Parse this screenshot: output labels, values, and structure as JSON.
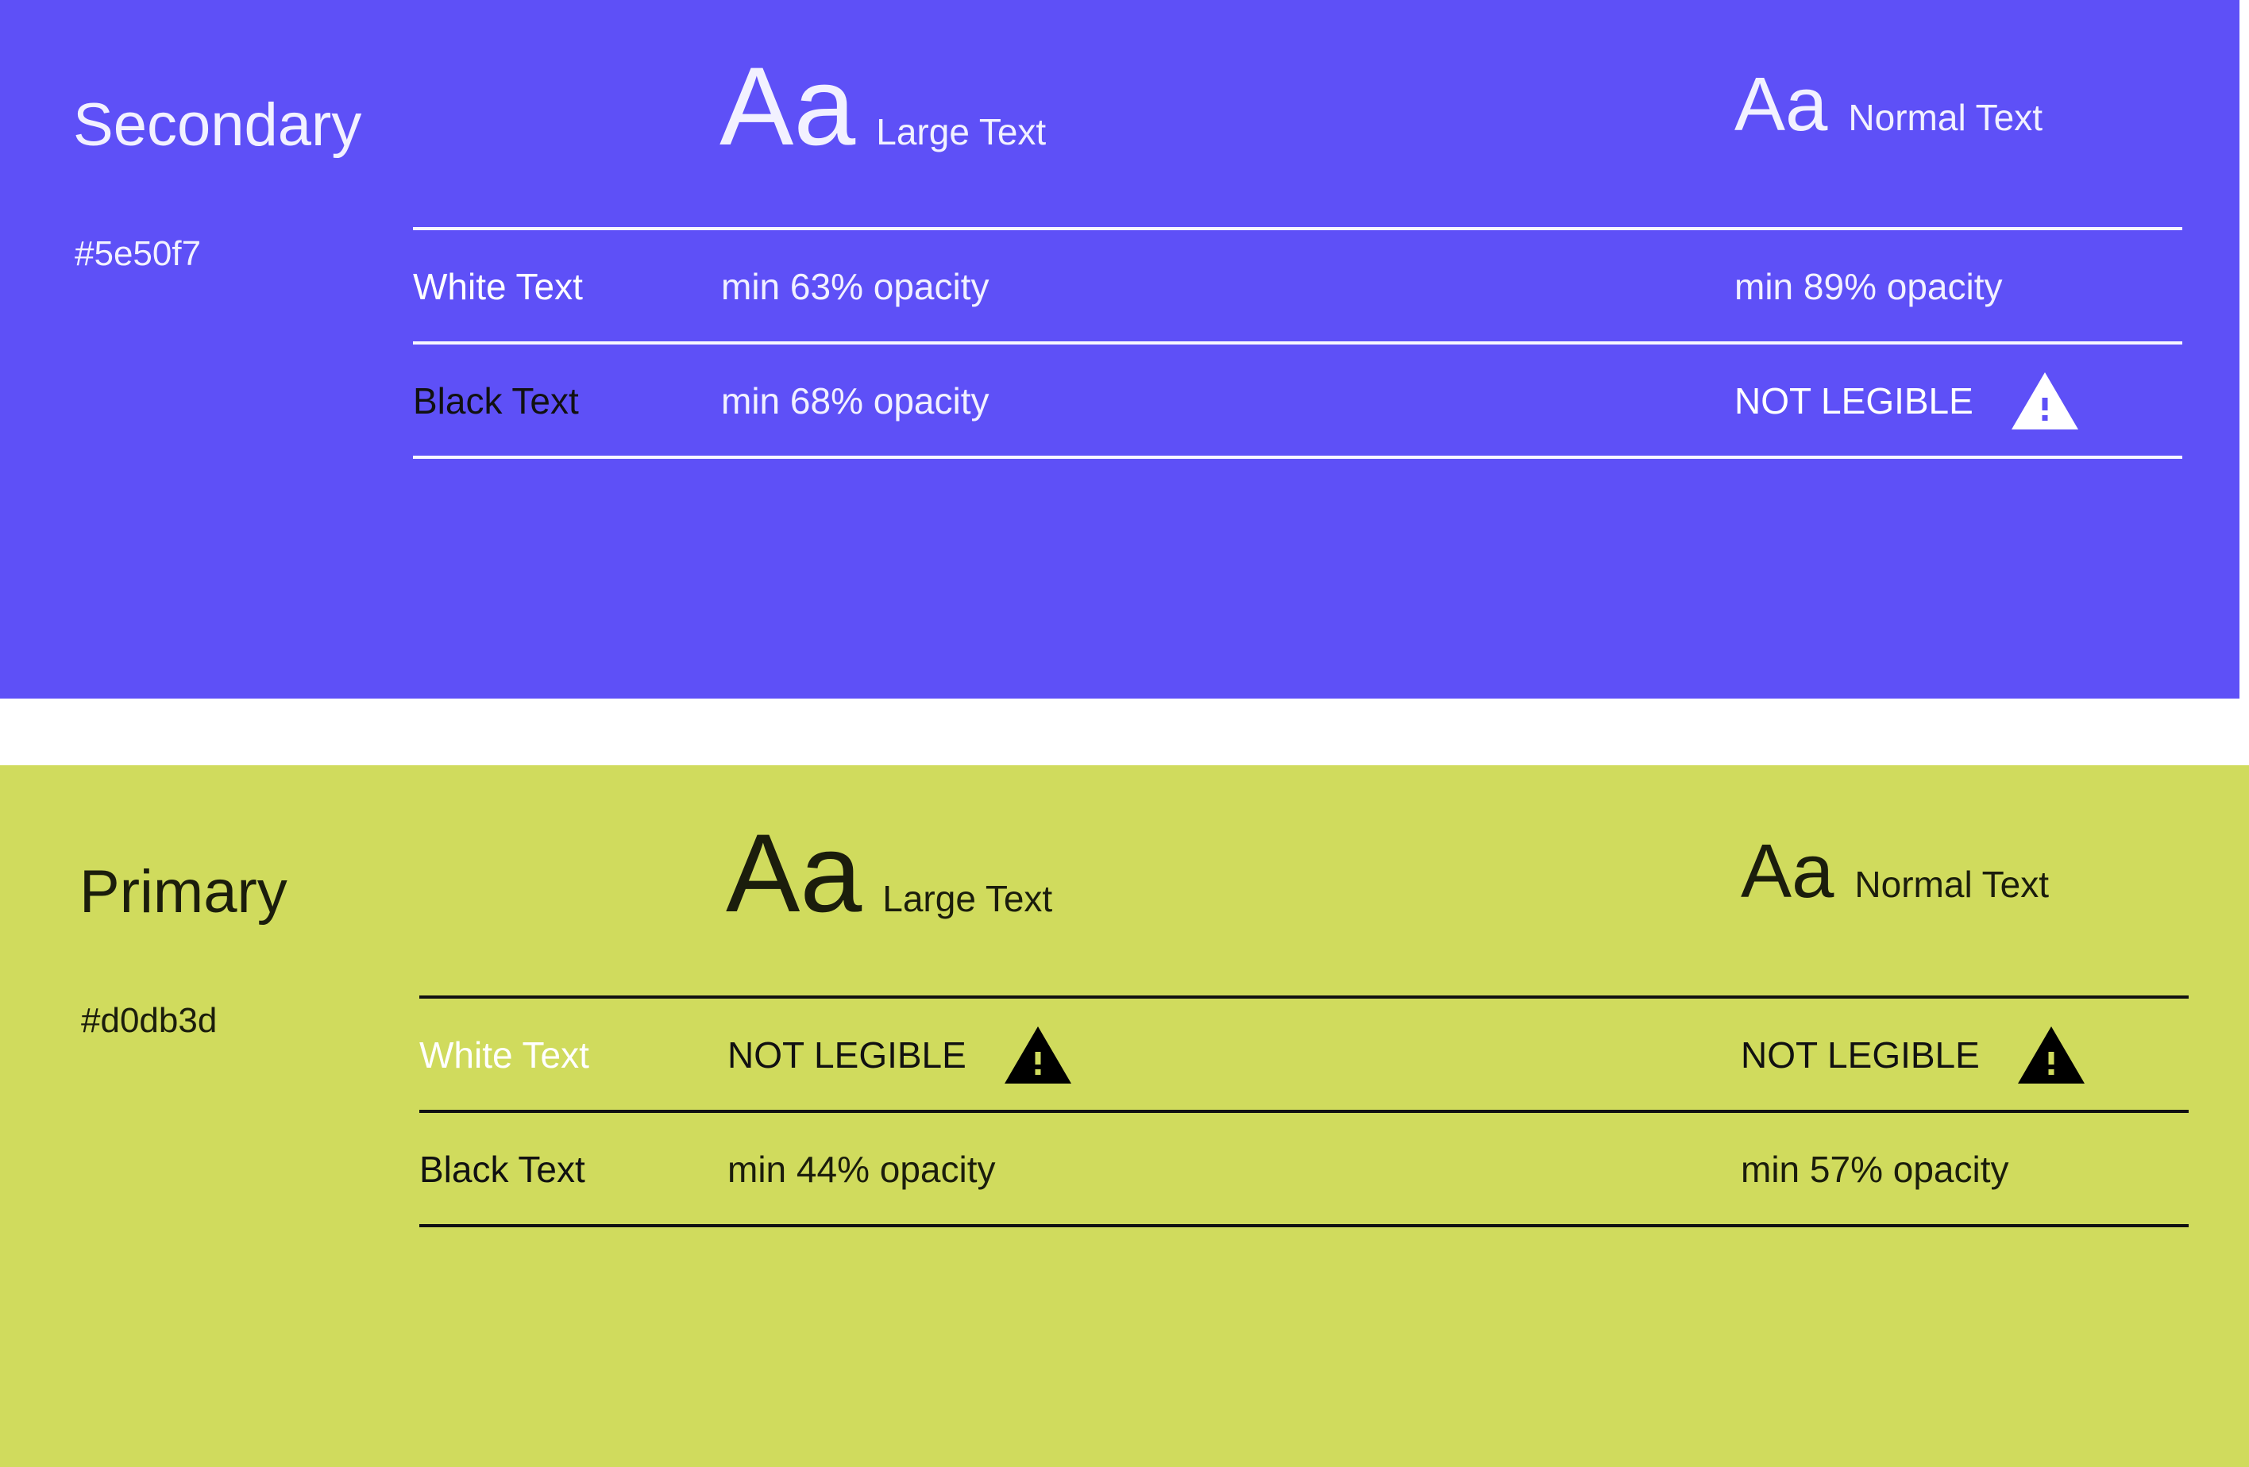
{
  "colors": {
    "secondary_bg": "#5e50f7",
    "primary_bg": "#d0db5d",
    "white_text": "#ffffff",
    "black_text": "#111111"
  },
  "secondary": {
    "name": "Secondary",
    "hex": "#5e50f7",
    "header": {
      "large_sample": "Aa",
      "large_label": "Large Text",
      "normal_sample": "Aa",
      "normal_label": "Normal Text"
    },
    "rows": [
      {
        "label": "White Text",
        "large": "min 63% opacity",
        "normal": "min 89% opacity"
      },
      {
        "label": "Black Text",
        "large": "min 68% opacity",
        "normal": "NOT LEGIBLE",
        "normal_icon": "warning-icon"
      }
    ]
  },
  "primary": {
    "name": "Primary",
    "hex": "#d0db3d",
    "header": {
      "large_sample": "Aa",
      "large_label": "Large Text",
      "normal_sample": "Aa",
      "normal_label": "Normal Text"
    },
    "rows": [
      {
        "label": "White Text",
        "large": "NOT LEGIBLE",
        "large_icon": "warning-icon",
        "normal": "NOT LEGIBLE",
        "normal_icon": "warning-icon"
      },
      {
        "label": "Black Text",
        "large": "min 44% opacity",
        "normal": "min 57% opacity"
      }
    ]
  }
}
